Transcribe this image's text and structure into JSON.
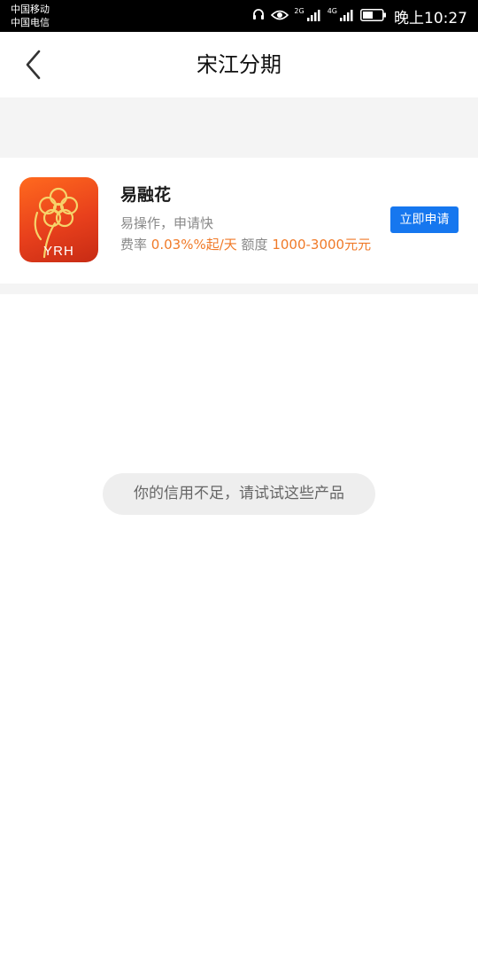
{
  "status_bar": {
    "carrier_1": "中国移动",
    "carrier_2": "中国电信",
    "net_1": "2G",
    "net_2": "4G",
    "time": "晚上10:27",
    "icons": [
      "headphones-icon",
      "eye-icon",
      "signal-icon",
      "signal-icon",
      "battery-icon"
    ]
  },
  "header": {
    "title": "宋江分期",
    "back_icon": "chevron-left-icon"
  },
  "product": {
    "logo_text": "YRH",
    "name": "易融花",
    "slogan": "易操作，申请快",
    "rate_label": "费率",
    "rate_value": "0.03%%起/天",
    "limit_label": "额度",
    "limit_value": "1000-3000元元",
    "apply_label": "立即申请"
  },
  "toast": {
    "message": "你的信用不足，请试试这些产品"
  },
  "colors": {
    "accent": "#f07a28",
    "button": "#1677ef",
    "logo": "#e8401c"
  }
}
